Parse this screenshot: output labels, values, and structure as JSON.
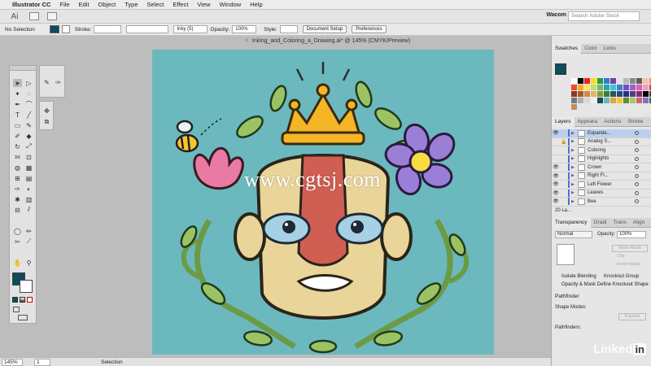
{
  "menubar": {
    "app_name": "Illustrator CC",
    "items": [
      "File",
      "Edit",
      "Object",
      "Type",
      "Select",
      "Effect",
      "View",
      "Window",
      "Help"
    ]
  },
  "appbar": {
    "logo": "Ai",
    "workspace": "Wacom",
    "search_placeholder": "Search Adobe Stock"
  },
  "control_bar": {
    "selection_label": "No Selection",
    "stroke_label": "Stroke:",
    "brush_value": "Inky (5)",
    "opacity_label": "Opacity:",
    "opacity_value": "100%",
    "style_label": "Style:",
    "document_setup": "Document Setup",
    "preferences": "Preferences"
  },
  "document": {
    "tab_title": "Inking_and_Coloring_a_Drawing.ai* @ 145% (CMYK/Preview)",
    "watermark": "www.cgtsj.com"
  },
  "status_bar": {
    "zoom": "145%",
    "page": "1",
    "tool": "Selection"
  },
  "swatches_panel": {
    "tabs": [
      "Swatches",
      "Color",
      "Links"
    ],
    "colors": [
      "#ffffff",
      "#000000",
      "#ee2424",
      "#f7e21a",
      "#2b9c3c",
      "#2d7fd4",
      "#7f3ea3",
      "#e3e3e3",
      "#b8b8b8",
      "#8a8a8a",
      "#5c5c5c",
      "#f5c1b0",
      "#f58c6e",
      "#f44b2c",
      "#f8a91f",
      "#fde36d",
      "#c6df6b",
      "#66c069",
      "#2aa8a1",
      "#38c3e6",
      "#3f7fd1",
      "#6a55c5",
      "#a25bc9",
      "#e060a8",
      "#f59cc2",
      "#c94a3c",
      "#8c3a2b",
      "#a35a2a",
      "#d08a44",
      "#e1b66a",
      "#889b3f",
      "#3f7a3e",
      "#205a58",
      "#1f4c86",
      "#2e2f7a",
      "#553a86",
      "#802d6f",
      "#000000",
      "#444444",
      "#7a7a7a",
      "#aeaeae",
      "#d9d9d9",
      "#f0f0f0",
      "#0f4c5c",
      "#6bb9be",
      "#e2a33e",
      "#f4c531",
      "#5d8e3b",
      "#a9c95a",
      "#d55d76",
      "#8470c6",
      "#2e6b4b",
      "#c58f5b"
    ]
  },
  "layers_panel": {
    "tabs": [
      "Layers",
      "Appeara",
      "Actions",
      "Stroke"
    ],
    "layers": [
      {
        "name": "Expande...",
        "visible": true,
        "locked": false,
        "selected": true
      },
      {
        "name": "Analog S...",
        "visible": false,
        "locked": true,
        "selected": false
      },
      {
        "name": "Coloring",
        "visible": false,
        "locked": false,
        "selected": false
      },
      {
        "name": "Highlights",
        "visible": false,
        "locked": false,
        "selected": false
      },
      {
        "name": "Crown",
        "visible": true,
        "locked": false,
        "selected": false
      },
      {
        "name": "Right Fl...",
        "visible": true,
        "locked": false,
        "selected": false
      },
      {
        "name": "Left Flower",
        "visible": true,
        "locked": false,
        "selected": false
      },
      {
        "name": "Leaves",
        "visible": true,
        "locked": false,
        "selected": false
      },
      {
        "name": "Bee",
        "visible": true,
        "locked": false,
        "selected": false
      }
    ],
    "count_label": "20 La..."
  },
  "transparency_panel": {
    "tabs": [
      "Transparency",
      "Gradi",
      "Trans",
      "Align"
    ],
    "blend_mode": "Normal",
    "opacity_label": "Opacity:",
    "opacity_value": "100%",
    "make_mask": "Make Mask",
    "clip": "Clip",
    "invert_mask": "Invert Mask",
    "isolate_blending": "Isolate Blending",
    "knockout_group": "Knockout Group",
    "opacity_mask_define": "Opacity & Mask Define Knockout Shape"
  },
  "pathfinder_panel": {
    "title": "Pathfinder",
    "shape_modes_label": "Shape Modes:",
    "expand": "Expand",
    "pathfinders_label": "Pathfinders:"
  },
  "branding": {
    "text": "Linked",
    "in": "in"
  }
}
